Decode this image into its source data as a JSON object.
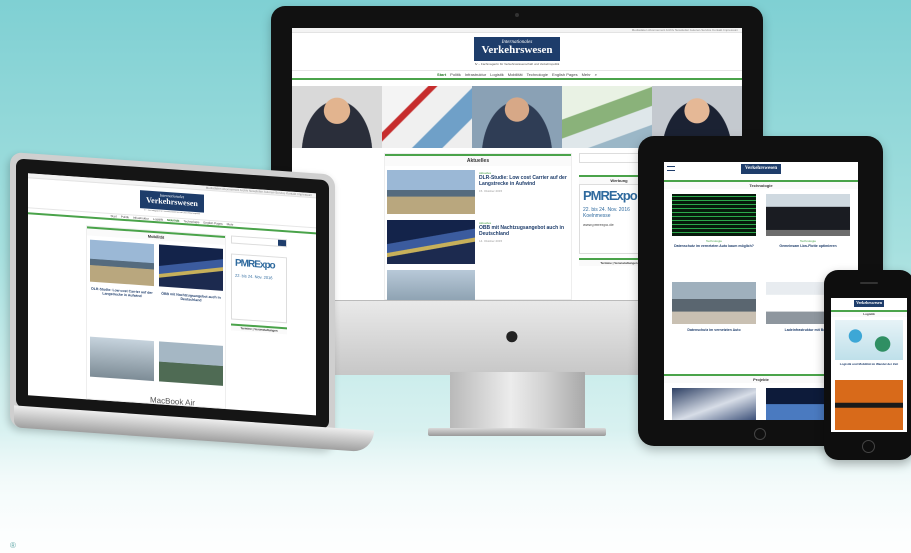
{
  "site": {
    "logo_line1": "Internationales",
    "logo_line2": "Verkehrswesen",
    "subtitle": "IV – Fachmagazin für Verkehrswissenschaft und Verkehrspolitik",
    "top_links": "Mediadaten  Abonnement  Archiv  Newsletter  Autoren-Service  Kontakt  Impressum",
    "nav": [
      "Start",
      "Politik",
      "Infrastruktur",
      "Logistik",
      "Mobilität",
      "Technologie",
      "English Pages",
      "Mehr"
    ],
    "nav_active": "Start"
  },
  "imac": {
    "section": "Aktuelles",
    "articles": [
      {
        "tag": "Aktuelles",
        "title": "DLR-Studie: Low cost Carrier auf der Langstrecke in Aufwind",
        "meta": "15. Oktober 2015"
      },
      {
        "tag": "Aktuelles",
        "title": "ÖBB mit Nachtzugsangebot auch in Deutschland",
        "meta": "14. Oktober 2015"
      }
    ],
    "sidebar_heading": "Werbung",
    "ad_brand": "PMRExpo",
    "ad_dates": "22. bis 24. Nov. 2016 Koelnmesse",
    "ad_url": "www.pmrexpo.de",
    "sidebar_heading2": "Termine | Veranstaltungen"
  },
  "laptop": {
    "section": "Mobilität",
    "articles": [
      {
        "title": "DLR-Studie: Low cost Carrier auf der Langstrecke in Aufwind"
      },
      {
        "title": "ÖBB mit Nachtzugsangebot auch in Deutschland"
      }
    ],
    "ad_brand": "PMRExpo",
    "ad_dates": "22. bis 24. Nov. 2016",
    "sidebar_heading2": "Termine | Veranstaltungen",
    "brand": "MacBook Air"
  },
  "ipad": {
    "section": "Technologie",
    "articles": [
      {
        "tag": "Technologie",
        "title": "Datenschutz im vernetzten Auto kaum möglich?"
      },
      {
        "tag": "Technologie",
        "title": "Gemeinsam Lkw-Flotte optimieren"
      },
      {
        "tag": "Technologie",
        "title": "Datenschutz im vernetzten Auto"
      },
      {
        "tag": "Technologie",
        "title": "Ladeinfrastruktur mit Bosch"
      }
    ],
    "section2": "Projekte"
  },
  "iphone": {
    "section": "Logistik",
    "article_title": "Logistik und Mobilität im Wandel der Zeit"
  },
  "footer_mark": "®"
}
